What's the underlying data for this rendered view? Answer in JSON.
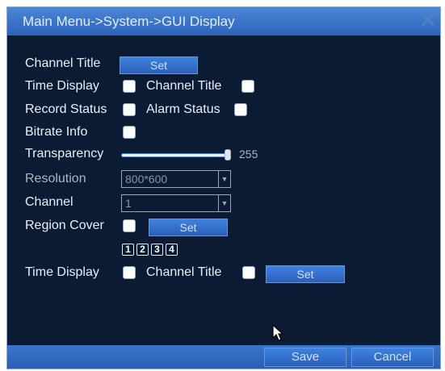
{
  "window": {
    "title": "Main Menu->System->GUI Display"
  },
  "labels": {
    "channel_title": "Channel Title",
    "time_display": "Time Display",
    "channel_title_toggle": "Channel Title",
    "record_status": "Record Status",
    "alarm_status": "Alarm Status",
    "bitrate_info": "Bitrate Info",
    "transparency": "Transparency",
    "resolution": "Resolution",
    "channel": "Channel",
    "region_cover": "Region Cover",
    "time_display_2": "Time Display",
    "channel_title_2": "Channel Title"
  },
  "buttons": {
    "channel_title_set": "Set",
    "region_cover_set": "Set",
    "overlay_set": "Set",
    "save": "Save",
    "cancel": "Cancel"
  },
  "transparency": {
    "value": "255",
    "level": 1.0
  },
  "resolution": {
    "value": "800*600"
  },
  "channel": {
    "value": "1"
  },
  "regions": [
    "1",
    "2",
    "3",
    "4"
  ],
  "colors": {
    "title_bar": "#3a75cc",
    "background": "#0b1b33",
    "button": "#2f6bc4"
  },
  "icons": {
    "close": "close-icon",
    "cursor": "mouse-pointer-icon"
  }
}
